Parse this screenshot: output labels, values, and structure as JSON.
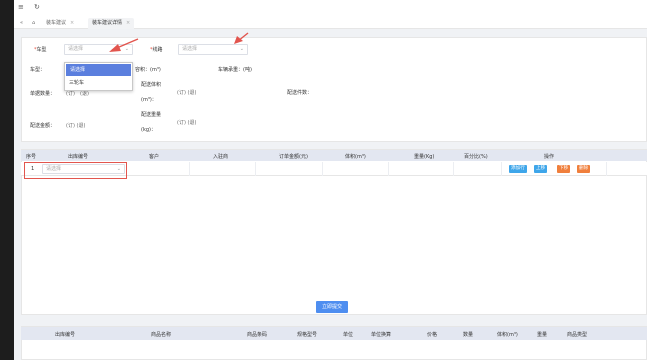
{
  "topbar": {
    "menu_icon": "≡",
    "refresh_icon": "↻"
  },
  "tabs": {
    "collapse_icon": "«",
    "home_icon": "⌂",
    "items": [
      {
        "label": "装车建议",
        "close": "×"
      },
      {
        "label": "装车建议详情",
        "close": "×"
      }
    ]
  },
  "form": {
    "vehicle_type": {
      "label": "车型",
      "required": "*",
      "placeholder": "请选择"
    },
    "route": {
      "label": "线路",
      "required": "*",
      "placeholder": "请选择"
    },
    "dropdown": {
      "options": [
        "请选择",
        "三轮车"
      ]
    },
    "info": {
      "vehicle_type_label": "车型：",
      "capacity_label": "容积：(m³)",
      "load_label": "车辆承重：(吨)",
      "order_count_label": "单据数量：",
      "order_count_unit": "(订)",
      "order_count_unit2": "(退)",
      "volume_label_1": "配送体积",
      "volume_label_2": "(m³)：",
      "volume_units": "(订) (退)",
      "items_label": "配送件数：",
      "amount_label": "配送金额：",
      "amount_units": "(订) (退)",
      "weight_label_1": "配送重量",
      "weight_label_2": "(kg)：",
      "weight_units": "(订) (退)"
    }
  },
  "orders_table": {
    "headers": [
      "序号",
      "出库编号",
      "客户",
      "入驻商",
      "订单金额(元)",
      "体积(m³)",
      "重量(Kg)",
      "百分比(%)",
      "操作"
    ],
    "row": {
      "index": "1",
      "placeholder": "请选择"
    },
    "actions": [
      {
        "label": "添加行",
        "color": "#3ea6ea"
      },
      {
        "label": "上移",
        "color": "#3ea6ea"
      },
      {
        "label": "下移",
        "color": "#f07f3c"
      },
      {
        "label": "删除",
        "color": "#f07f3c"
      }
    ],
    "submit_label": "立即提交"
  },
  "goods_table": {
    "headers": [
      "出库编号",
      "商品名称",
      "商品条码",
      "规格型号",
      "单位",
      "单位换算",
      "价格",
      "数量",
      "体积(m³)",
      "重量",
      "商品类型"
    ]
  },
  "colors": {
    "accent": "#4e8ef0",
    "annotation": "#e2554e",
    "required": "#e64d3d"
  }
}
